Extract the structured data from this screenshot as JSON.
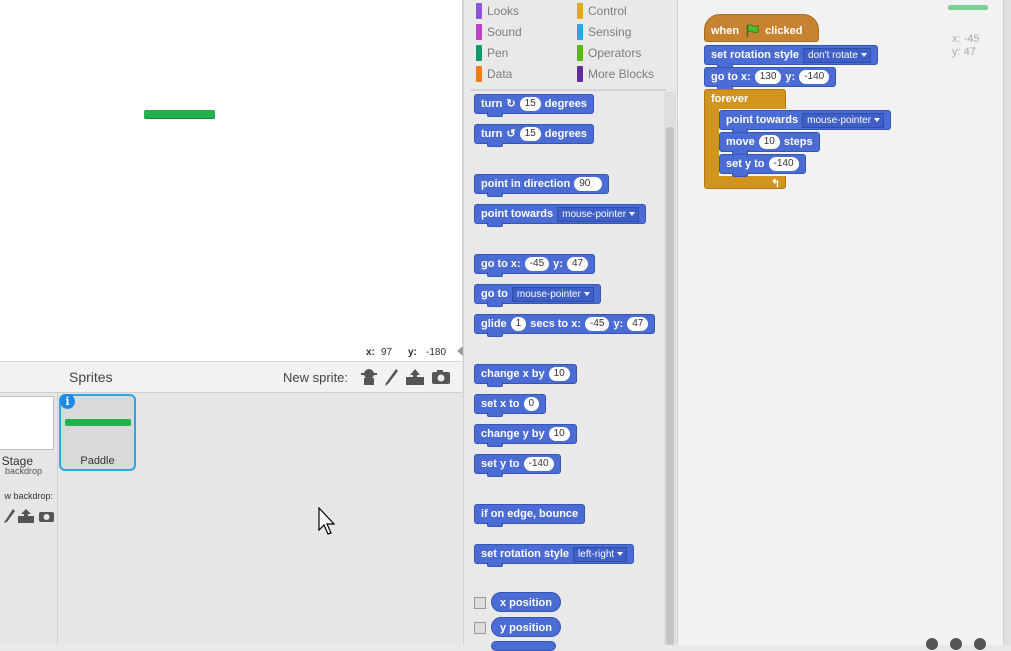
{
  "stage": {
    "coords": {
      "x_label": "x:",
      "x_value": "97",
      "y_label": "y:",
      "y_value": "-180"
    }
  },
  "sprites_pane": {
    "title": "Sprites",
    "new_sprite_label": "New sprite:",
    "stage_label": "Stage",
    "stage_sub": "backdrop",
    "new_backdrop_label": "w backdrop:",
    "sprite_name": "Paddle",
    "info_glyph": "i"
  },
  "categories": [
    {
      "label": "Looks",
      "color": "#8a55d7"
    },
    {
      "label": "Sound",
      "color": "#bb42c3"
    },
    {
      "label": "Pen",
      "color": "#0e9a6c"
    },
    {
      "label": "Data",
      "color": "#ee7d16"
    },
    {
      "label": "Control",
      "color": "#e1a91a"
    },
    {
      "label": "Sensing",
      "color": "#2ca5e2"
    },
    {
      "label": "Operators",
      "color": "#5cb712"
    },
    {
      "label": "More Blocks",
      "color": "#632d99"
    }
  ],
  "palette": {
    "turn_right": {
      "pre": "turn",
      "value": "15",
      "post": "degrees"
    },
    "turn_left": {
      "pre": "turn",
      "value": "15",
      "post": "degrees"
    },
    "point_dir": {
      "pre": "point in direction",
      "value": "90"
    },
    "point_towards": {
      "pre": "point towards",
      "value": "mouse-pointer"
    },
    "goto_xy": {
      "pre": "go to x:",
      "x": "-45",
      "mid": "y:",
      "y": "47"
    },
    "goto": {
      "pre": "go to",
      "value": "mouse-pointer"
    },
    "glide": {
      "pre": "glide",
      "secs": "1",
      "mid1": "secs to x:",
      "x": "-45",
      "mid2": "y:",
      "y": "47"
    },
    "change_x": {
      "pre": "change x by",
      "value": "10"
    },
    "set_x": {
      "pre": "set x to",
      "value": "0"
    },
    "change_y": {
      "pre": "change y by",
      "value": "10"
    },
    "set_y": {
      "pre": "set y to",
      "value": "-140"
    },
    "bounce": "if on edge, bounce",
    "rotation": {
      "pre": "set rotation style",
      "value": "left-right"
    },
    "x_position": "x position",
    "y_position": "y position"
  },
  "script": {
    "hat_when": "when",
    "hat_clicked": "clicked",
    "rotation": {
      "pre": "set rotation style",
      "value": "don't rotate"
    },
    "goto": {
      "pre": "go to x:",
      "x": "130",
      "mid": "y:",
      "y": "-140"
    },
    "forever": "forever",
    "point_towards": {
      "pre": "point towards",
      "value": "mouse-pointer"
    },
    "move": {
      "pre": "move",
      "value": "10",
      "post": "steps"
    },
    "set_y": {
      "pre": "set y to",
      "value": "-140"
    }
  },
  "readout": {
    "x": "x: -45",
    "y": "y: 47"
  }
}
